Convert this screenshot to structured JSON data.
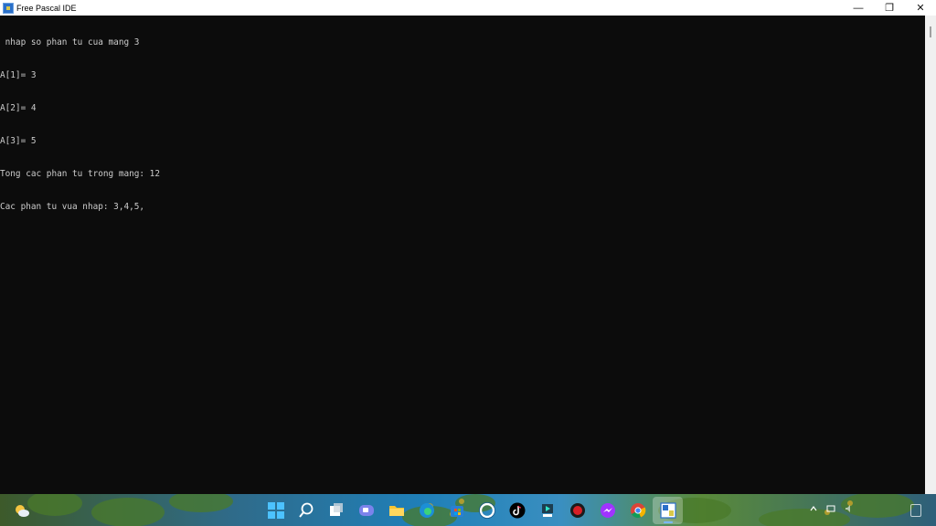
{
  "window": {
    "title": "Free Pascal IDE",
    "controls": {
      "minimize": "—",
      "restore": "❐",
      "close": "✕"
    }
  },
  "console": {
    "lines": [
      " nhap so phan tu cua mang 3",
      "A[1]= 3",
      "A[2]= 4",
      "A[3]= 5",
      "Tong cac phan tu trong mang: 12",
      "Cac phan tu vua nhap: 3,4,5,"
    ],
    "text_color": "#cccccc",
    "background": "#0c0c0c"
  },
  "taskbar": {
    "icons": [
      {
        "name": "start-icon",
        "glyph": "windows"
      },
      {
        "name": "search-icon",
        "glyph": "search"
      },
      {
        "name": "task-view-icon",
        "glyph": "taskview"
      },
      {
        "name": "chat-icon",
        "glyph": "chat"
      },
      {
        "name": "file-explorer-icon",
        "glyph": "folder"
      },
      {
        "name": "edge-icon",
        "glyph": "edge"
      },
      {
        "name": "store-icon",
        "glyph": "store"
      },
      {
        "name": "cortana-icon",
        "glyph": "circle"
      },
      {
        "name": "tiktok-icon",
        "glyph": "tiktok"
      },
      {
        "name": "media-app-icon",
        "glyph": "media"
      },
      {
        "name": "antivirus-icon",
        "glyph": "shield"
      },
      {
        "name": "messenger-icon",
        "glyph": "messenger"
      },
      {
        "name": "chrome-icon",
        "glyph": "chrome"
      },
      {
        "name": "free-pascal-icon",
        "glyph": "pascal",
        "active": true
      }
    ],
    "accent": "#1f7fb8"
  }
}
